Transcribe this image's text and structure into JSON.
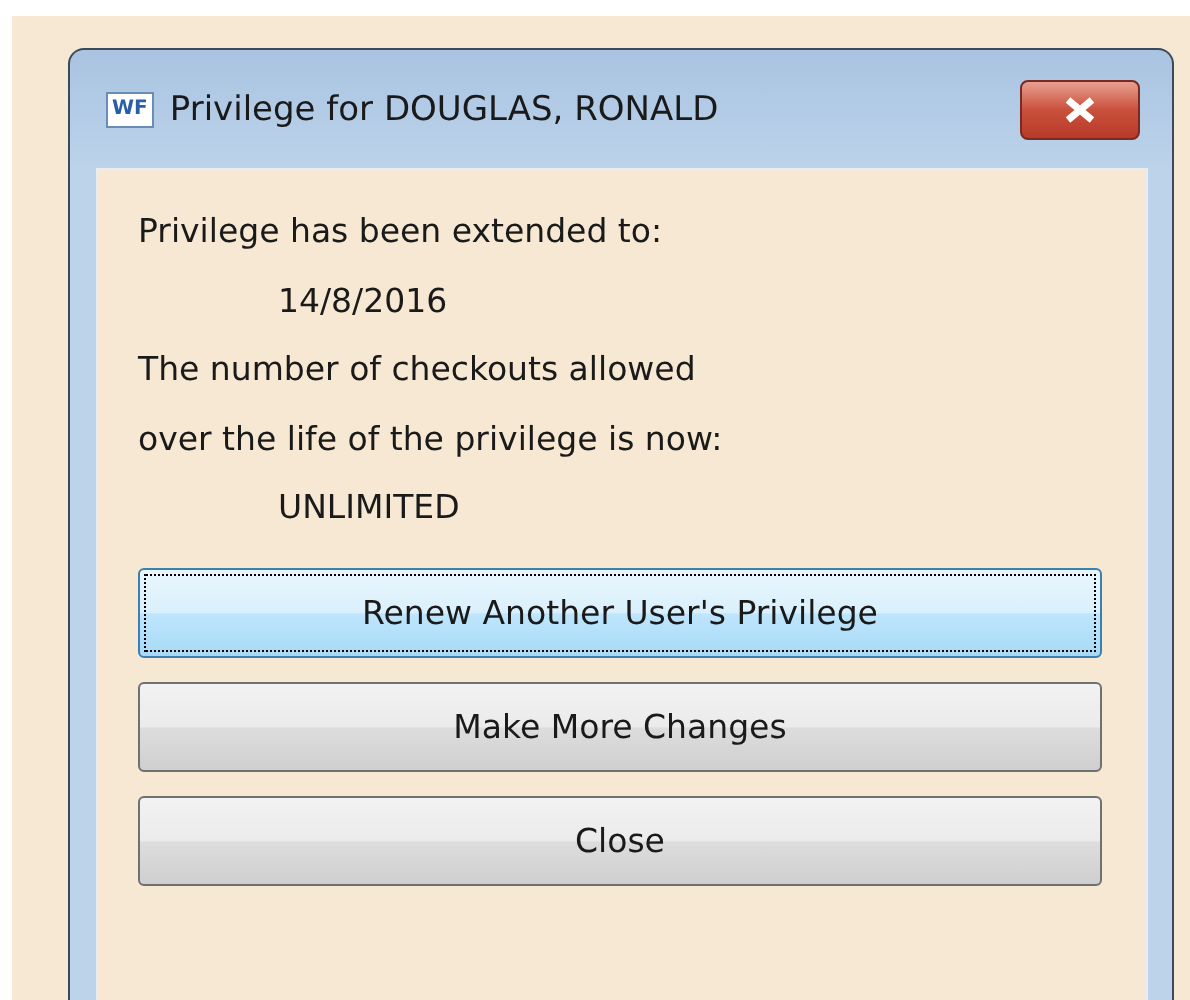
{
  "window": {
    "icon_text": "WF",
    "title": "Privilege for DOUGLAS, RONALD"
  },
  "message": [
    {
      "text": "Privilege has been extended to:",
      "indented": false
    },
    {
      "text": "14/8/2016",
      "indented": true
    },
    {
      "text": "The number of checkouts allowed",
      "indented": false
    },
    {
      "text": "over the life of the privilege is now:",
      "indented": false
    },
    {
      "text": "UNLIMITED",
      "indented": true
    }
  ],
  "buttons": [
    {
      "label": "Renew Another User's Privilege",
      "focused": true
    },
    {
      "label": "Make More Changes",
      "focused": false
    },
    {
      "label": "Close",
      "focused": false
    }
  ]
}
